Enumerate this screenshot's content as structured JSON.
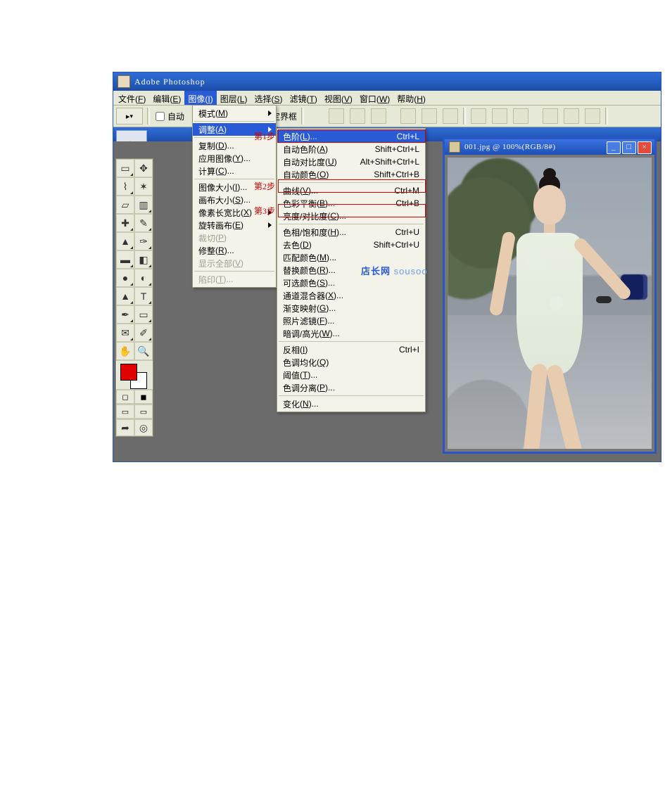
{
  "titlebar": {
    "app": "Adobe Photoshop"
  },
  "menubar": {
    "file": {
      "label": "文件",
      "accel": "F"
    },
    "edit": {
      "label": "编辑",
      "accel": "E"
    },
    "image": {
      "label": "图像",
      "accel": "I"
    },
    "layer": {
      "label": "图层",
      "accel": "L"
    },
    "select": {
      "label": "选择",
      "accel": "S"
    },
    "filter": {
      "label": "滤镜",
      "accel": "T"
    },
    "view": {
      "label": "视图",
      "accel": "V"
    },
    "window": {
      "label": "窗口",
      "accel": "W"
    },
    "help": {
      "label": "帮助",
      "accel": "H"
    }
  },
  "optionbar": {
    "auto_prefix": "自动",
    "bbox_suffix": "定界框"
  },
  "toolbox": {
    "fg_color": "#e00000",
    "bg_color": "#ffffff"
  },
  "menu_image": {
    "mode": {
      "label": "模式",
      "accel": "M"
    },
    "adjust": {
      "label": "调整",
      "accel": "A"
    },
    "duplicate": {
      "label": "复制",
      "accel": "D"
    },
    "apply_img": {
      "label": "应用图像",
      "accel": "Y"
    },
    "calc": {
      "label": "计算",
      "accel": "C"
    },
    "img_size": {
      "label": "图像大小",
      "accel": "I"
    },
    "canvas_size": {
      "label": "画布大小",
      "accel": "S"
    },
    "pix_aspect": {
      "label": "像素长宽比",
      "accel": "X"
    },
    "rotate": {
      "label": "旋转画布",
      "accel": "E"
    },
    "crop": {
      "label": "裁切",
      "accel": "P"
    },
    "trim": {
      "label": "修整",
      "accel": "R"
    },
    "reveal_all": {
      "label": "显示全部",
      "accel": "V"
    },
    "trap": {
      "label": "陷印",
      "accel": "T"
    }
  },
  "menu_adjust": {
    "levels": {
      "label": "色阶",
      "accel": "L",
      "short": "Ctrl+L"
    },
    "auto_levels": {
      "label": "自动色阶",
      "accel": "A",
      "short": "Shift+Ctrl+L"
    },
    "auto_contrast": {
      "label": "自动对比度",
      "accel": "U",
      "short": "Alt+Shift+Ctrl+L"
    },
    "auto_color": {
      "label": "自动颜色",
      "accel": "O",
      "short": "Shift+Ctrl+B"
    },
    "curves": {
      "label": "曲线",
      "accel": "V",
      "short": "Ctrl+M"
    },
    "color_balance": {
      "label": "色彩平衡",
      "accel": "B",
      "short": "Ctrl+B"
    },
    "bright_contrast": {
      "label": "亮度/对比度",
      "accel": "C"
    },
    "hue_sat": {
      "label": "色相/饱和度",
      "accel": "H",
      "short": "Ctrl+U"
    },
    "desat": {
      "label": "去色",
      "accel": "D",
      "short": "Shift+Ctrl+U"
    },
    "match_color": {
      "label": "匹配颜色",
      "accel": "M"
    },
    "replace_color": {
      "label": "替换颜色",
      "accel": "R"
    },
    "selective": {
      "label": "可选颜色",
      "accel": "S"
    },
    "channel_mixer": {
      "label": "通道混合器",
      "accel": "X"
    },
    "grad_map": {
      "label": "渐变映射",
      "accel": "G"
    },
    "photo_filter": {
      "label": "照片滤镜",
      "accel": "F"
    },
    "shadow_hl": {
      "label": "暗调/高光",
      "accel": "W"
    },
    "invert": {
      "label": "反相",
      "accel": "I",
      "short": "Ctrl+I"
    },
    "equalize": {
      "label": "色调均化",
      "accel": "Q"
    },
    "threshold": {
      "label": "阈值",
      "accel": "T"
    },
    "posterize": {
      "label": "色调分离",
      "accel": "P"
    },
    "variations": {
      "label": "变化",
      "accel": "N"
    }
  },
  "annotations": {
    "step1": "第1步",
    "step2": "第2步",
    "step3": "第3步"
  },
  "docwin": {
    "title": "001.jpg @ 100%(RGB/8#)"
  },
  "watermark": {
    "cn": "店长网",
    "en": "sousoo"
  }
}
